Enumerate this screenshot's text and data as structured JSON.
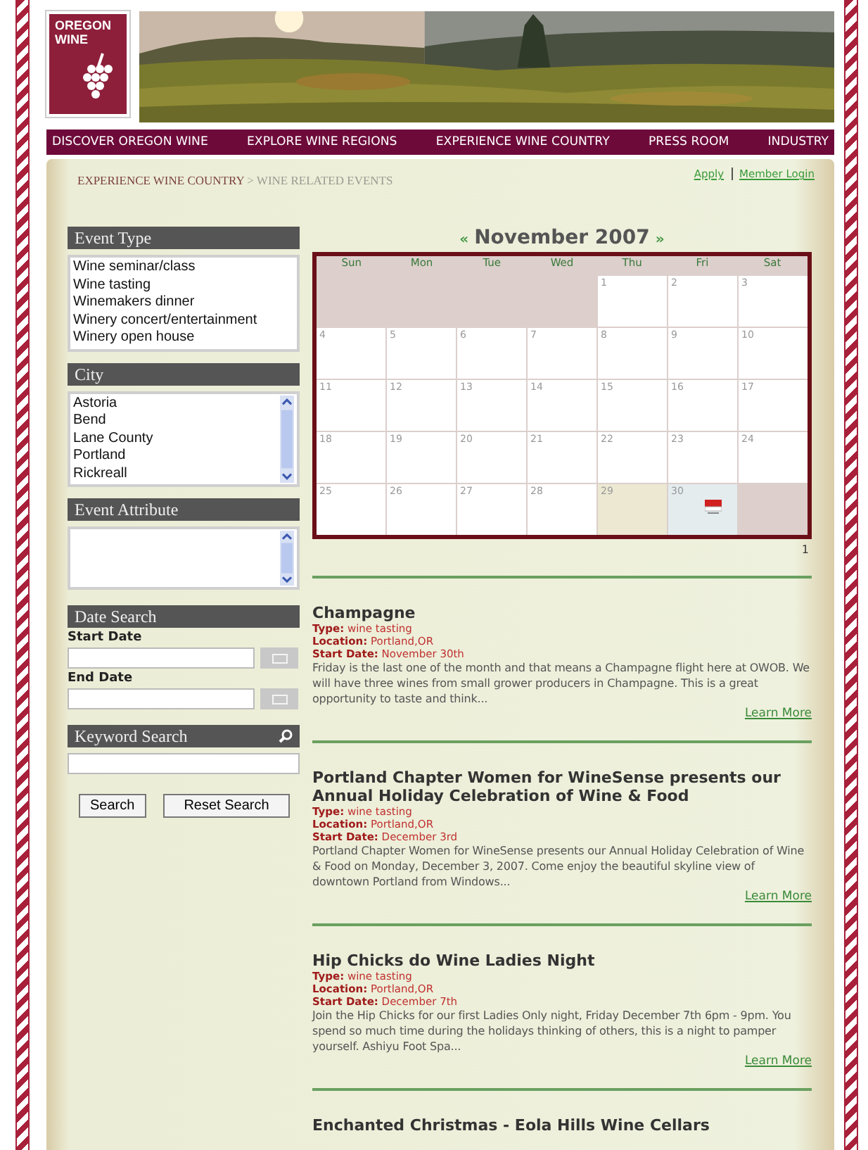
{
  "logo": {
    "lines": [
      "OREGON",
      "WINE"
    ]
  },
  "nav": [
    "DISCOVER OREGON WINE",
    "EXPLORE WINE REGIONS",
    "EXPERIENCE WINE COUNTRY",
    "PRESS ROOM",
    "INDUSTRY"
  ],
  "breadcrumb": {
    "parent": "EXPERIENCE WINE COUNTRY",
    "separator": ">",
    "current": "WINE RELATED EVENTS"
  },
  "account_links": [
    "Apply",
    "Member Login"
  ],
  "sidebar": {
    "event_type": {
      "title": "Event Type",
      "options": [
        "Wine seminar/class",
        "Wine tasting",
        "Winemakers dinner",
        "Winery concert/entertainment",
        "Winery open house"
      ]
    },
    "city": {
      "title": "City",
      "options": [
        "Astoria",
        "Bend",
        "Lane County",
        "Portland",
        "Rickreall"
      ]
    },
    "event_attribute": {
      "title": "Event Attribute"
    },
    "date_search": {
      "title": "Date Search",
      "start_label": "Start Date",
      "end_label": "End Date"
    },
    "keyword_search": {
      "title": "Keyword Search"
    },
    "buttons": [
      "Search",
      "Reset Search"
    ]
  },
  "calendar": {
    "prev": "«",
    "title": "November 2007",
    "next": "»",
    "weekdays": [
      "Sun",
      "Mon",
      "Tue",
      "Wed",
      "Thu",
      "Fri",
      "Sat"
    ],
    "weeks": [
      [
        {
          "kind": "blank"
        },
        {
          "kind": "blank"
        },
        {
          "kind": "blank"
        },
        {
          "kind": "blank"
        },
        {
          "kind": "day",
          "day": "1"
        },
        {
          "kind": "day",
          "day": "2"
        },
        {
          "kind": "day",
          "day": "3"
        }
      ],
      [
        {
          "kind": "day",
          "day": "4"
        },
        {
          "kind": "day",
          "day": "5"
        },
        {
          "kind": "day",
          "day": "6"
        },
        {
          "kind": "day",
          "day": "7"
        },
        {
          "kind": "day",
          "day": "8"
        },
        {
          "kind": "day",
          "day": "9"
        },
        {
          "kind": "day",
          "day": "10"
        }
      ],
      [
        {
          "kind": "day",
          "day": "11"
        },
        {
          "kind": "day",
          "day": "12"
        },
        {
          "kind": "day",
          "day": "13"
        },
        {
          "kind": "day",
          "day": "14"
        },
        {
          "kind": "day",
          "day": "15"
        },
        {
          "kind": "day",
          "day": "16"
        },
        {
          "kind": "day",
          "day": "17"
        }
      ],
      [
        {
          "kind": "day",
          "day": "18"
        },
        {
          "kind": "day",
          "day": "19"
        },
        {
          "kind": "day",
          "day": "20"
        },
        {
          "kind": "day",
          "day": "21"
        },
        {
          "kind": "day",
          "day": "22"
        },
        {
          "kind": "day",
          "day": "23"
        },
        {
          "kind": "day",
          "day": "24"
        }
      ],
      [
        {
          "kind": "day",
          "day": "25"
        },
        {
          "kind": "day",
          "day": "26"
        },
        {
          "kind": "day",
          "day": "27"
        },
        {
          "kind": "day",
          "day": "28"
        },
        {
          "kind": "today",
          "day": "29"
        },
        {
          "kind": "event",
          "day": "30"
        },
        {
          "kind": "blank"
        }
      ]
    ],
    "page": "1"
  },
  "events": [
    {
      "title": "Champagne",
      "type_label": "Type:",
      "location_label": "Location:",
      "start_date_label": "Start Date:",
      "type": "wine tasting",
      "location": "Portland,OR",
      "start_date": "November 30th",
      "description": "Friday is the last one of the month and that means a Champagne flight here at OWOB. We will have three wines from small grower producers in Champagne. This is a great opportunity to taste and think...",
      "link": "Learn More"
    },
    {
      "title": "Portland Chapter Women for WineSense presents our Annual Holiday Celebration of Wine & Food",
      "type_label": "Type:",
      "location_label": "Location:",
      "start_date_label": "Start Date:",
      "type": "wine tasting",
      "location": "Portland,OR",
      "start_date": "December 3rd",
      "description": "Portland Chapter Women for WineSense presents our Annual Holiday Celebration of Wine & Food on Monday, December 3, 2007. Come enjoy the beautiful skyline view of downtown Portland from Windows...",
      "link": "Learn More"
    },
    {
      "title": "Hip Chicks do Wine Ladies Night",
      "type_label": "Type:",
      "location_label": "Location:",
      "start_date_label": "Start Date:",
      "type": "wine tasting",
      "location": "Portland,OR",
      "start_date": "December 7th",
      "description": "Join the Hip Chicks for our first Ladies Only night, Friday December 7th 6pm - 9pm. You spend so much time during the holidays thinking of others, this is a night to pamper yourself. Ashiyu Foot Spa...",
      "link": "Learn More"
    },
    {
      "title": "Enchanted Christmas - Eola Hills Wine Cellars"
    }
  ]
}
